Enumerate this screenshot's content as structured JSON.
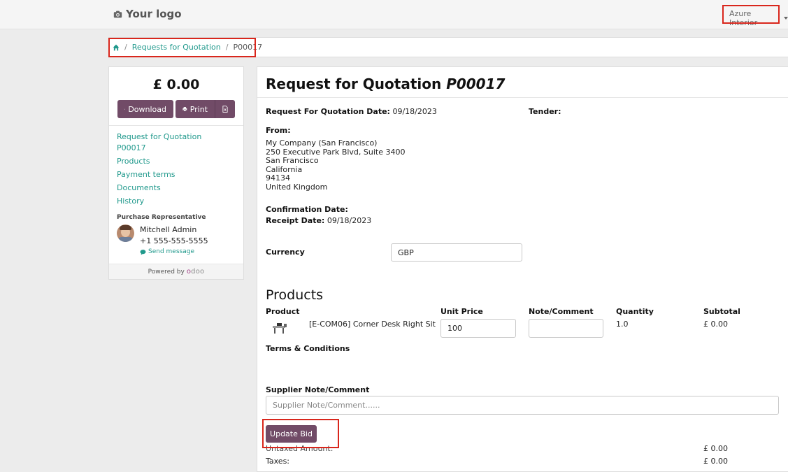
{
  "header": {
    "logo_text": "Your logo",
    "company_selector": "Azure Interior"
  },
  "breadcrumb": {
    "home_icon": "home-icon",
    "items": [
      "Requests for Quotation",
      "P00017"
    ],
    "separator": "/"
  },
  "sidebar": {
    "amount": "£ 0.00",
    "download_label": "Download",
    "print_label": "Print",
    "nav": [
      "Request for Quotation",
      "P00017",
      "Products",
      "Payment terms",
      "Documents",
      "History"
    ],
    "rep_title": "Purchase Representative",
    "rep_name": "Mitchell Admin",
    "rep_phone": "+1 555-555-5555",
    "send_message": "Send message",
    "powered_by": "Powered by",
    "odoo_brand": "odoo"
  },
  "main": {
    "title_prefix": "Request for Quotation",
    "title_ref": "P00017",
    "rfq_date_label": "Request For Quotation Date:",
    "rfq_date": "09/18/2023",
    "tender_label": "Tender:",
    "from_label": "From:",
    "address": [
      "My Company (San Francisco)",
      "250 Executive Park Blvd, Suite 3400",
      "San Francisco",
      "California",
      "94134",
      "United Kingdom"
    ],
    "confirmation_label": "Confirmation Date:",
    "receipt_label": "Receipt Date:",
    "receipt_date": "09/18/2023",
    "currency_label": "Currency",
    "currency_value": "GBP",
    "products_heading": "Products",
    "columns": [
      "Product",
      "Unit Price",
      "Note/Comment",
      "Quantity",
      "Subtotal"
    ],
    "product": {
      "name": "[E-COM06] Corner Desk Right Sit",
      "unit_price": "100",
      "note": "",
      "quantity": "1.0",
      "subtotal": "£ 0.00"
    },
    "terms_label": "Terms & Conditions",
    "supplier_note_label": "Supplier Note/Comment",
    "supplier_note_placeholder": "Supplier Note/Comment......",
    "update_bid_label": "Update Bid",
    "untaxed_label": "Untaxed Amount:",
    "untaxed_value": "£ 0.00",
    "taxes_label": "Taxes:",
    "taxes_value": "£ 0.00"
  },
  "colors": {
    "accent": "#714b67",
    "link": "#20998c",
    "highlight": "#d9261c"
  }
}
